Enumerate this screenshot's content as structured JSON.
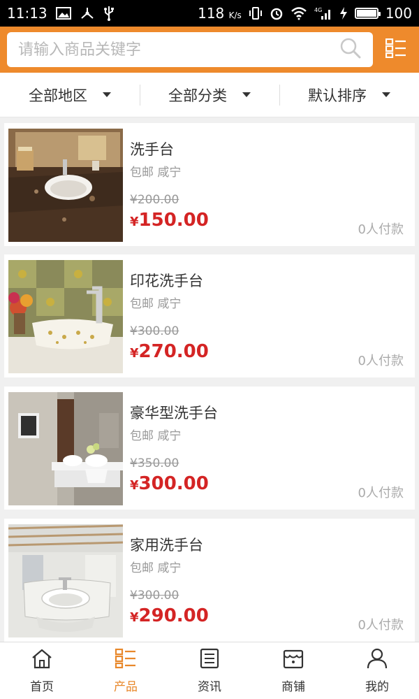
{
  "status_bar": {
    "time": "11:13",
    "net_speed": "118",
    "net_unit": "K/s",
    "battery": "100",
    "icons": [
      "image-icon",
      "usb-tether-icon",
      "usb-icon",
      "vibrate-icon",
      "alarm-icon",
      "wifi-icon",
      "4g-signal-icon",
      "charging-icon",
      "battery-icon"
    ]
  },
  "search": {
    "placeholder": "请输入商品关键字",
    "value": ""
  },
  "filters": [
    {
      "label": "全部地区"
    },
    {
      "label": "全部分类"
    },
    {
      "label": "默认排序"
    }
  ],
  "products": [
    {
      "name": "洗手台",
      "meta": "包邮 咸宁",
      "old_price": "¥200.00",
      "currency": "¥",
      "price": "150.00",
      "paid": "0人付款"
    },
    {
      "name": "印花洗手台",
      "meta": "包邮 咸宁",
      "old_price": "¥300.00",
      "currency": "¥",
      "price": "270.00",
      "paid": "0人付款"
    },
    {
      "name": "豪华型洗手台",
      "meta": "包邮 咸宁",
      "old_price": "¥350.00",
      "currency": "¥",
      "price": "300.00",
      "paid": "0人付款"
    },
    {
      "name": "家用洗手台",
      "meta": "包邮 咸宁",
      "old_price": "¥300.00",
      "currency": "¥",
      "price": "290.00",
      "paid": "0人付款"
    }
  ],
  "nav": [
    {
      "label": "首页",
      "icon": "home-icon",
      "active": false
    },
    {
      "label": "产品",
      "icon": "product-list-icon",
      "active": true
    },
    {
      "label": "资讯",
      "icon": "news-icon",
      "active": false
    },
    {
      "label": "商铺",
      "icon": "shop-icon",
      "active": false
    },
    {
      "label": "我的",
      "icon": "user-icon",
      "active": false
    }
  ],
  "colors": {
    "accent": "#ee8a2c",
    "price": "#d42424",
    "active_nav": "#e8882b"
  }
}
